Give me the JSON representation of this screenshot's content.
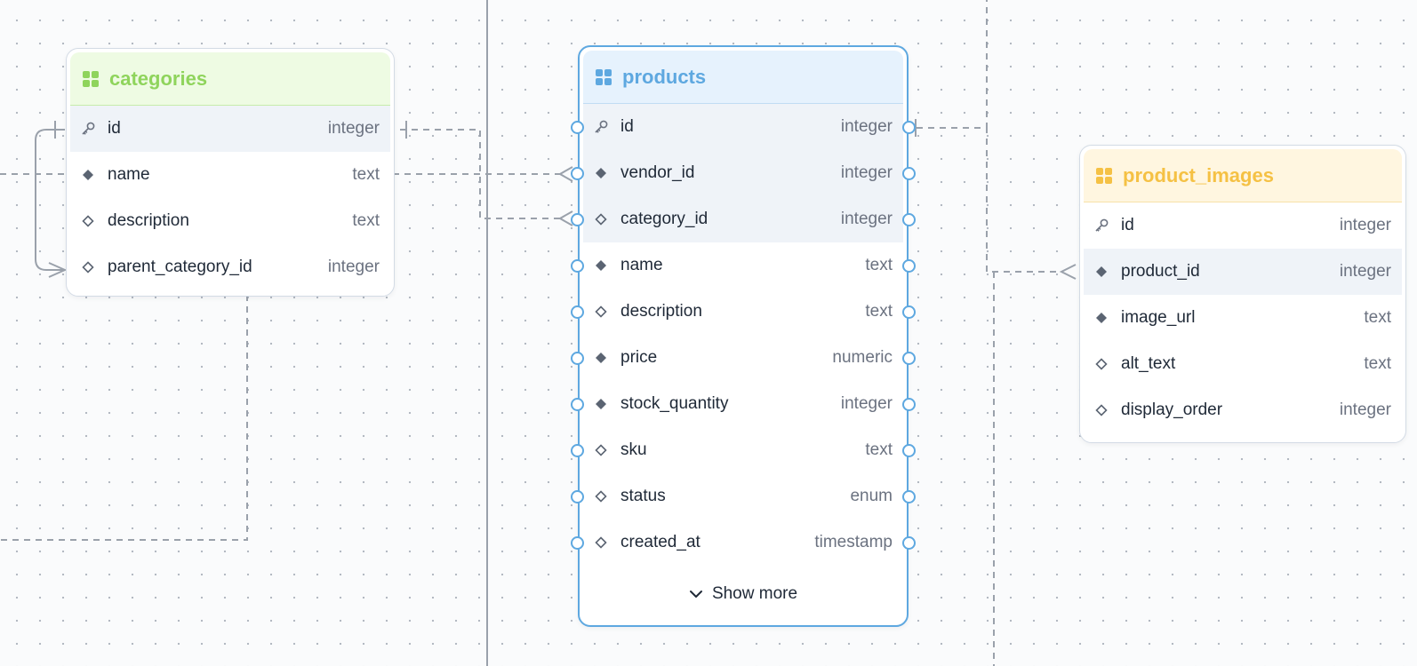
{
  "colors": {
    "accent": "#5ea8e0",
    "categories_header_bg": "#eefbe3",
    "categories_title": "#8fd45c",
    "products_header_bg": "#e6f2fd",
    "products_title": "#5ea8e0",
    "product_images_header_bg": "#fff6e0",
    "product_images_title": "#f5c144",
    "edge": "#9aa1ab"
  },
  "tables": {
    "categories": {
      "title": "categories",
      "icon": "table-grid-icon",
      "columns": [
        {
          "name": "id",
          "type": "integer",
          "icon": "key-icon"
        },
        {
          "name": "name",
          "type": "text",
          "icon": "filled-diamond-icon"
        },
        {
          "name": "description",
          "type": "text",
          "icon": "hollow-diamond-icon"
        },
        {
          "name": "parent_category_id",
          "type": "integer",
          "icon": "hollow-diamond-icon"
        }
      ]
    },
    "products": {
      "title": "products",
      "icon": "table-grid-icon",
      "columns": [
        {
          "name": "id",
          "type": "integer",
          "icon": "key-icon"
        },
        {
          "name": "vendor_id",
          "type": "integer",
          "icon": "filled-diamond-icon"
        },
        {
          "name": "category_id",
          "type": "integer",
          "icon": "hollow-diamond-icon"
        },
        {
          "name": "name",
          "type": "text",
          "icon": "filled-diamond-icon"
        },
        {
          "name": "description",
          "type": "text",
          "icon": "hollow-diamond-icon"
        },
        {
          "name": "price",
          "type": "numeric",
          "icon": "filled-diamond-icon"
        },
        {
          "name": "stock_quantity",
          "type": "integer",
          "icon": "filled-diamond-icon"
        },
        {
          "name": "sku",
          "type": "text",
          "icon": "hollow-diamond-icon"
        },
        {
          "name": "status",
          "type": "enum",
          "icon": "hollow-diamond-icon"
        },
        {
          "name": "created_at",
          "type": "timestamp",
          "icon": "hollow-diamond-icon"
        }
      ],
      "show_more_label": "Show more"
    },
    "product_images": {
      "title": "product_images",
      "icon": "table-grid-icon",
      "columns": [
        {
          "name": "id",
          "type": "integer",
          "icon": "key-icon"
        },
        {
          "name": "product_id",
          "type": "integer",
          "icon": "filled-diamond-icon"
        },
        {
          "name": "image_url",
          "type": "text",
          "icon": "filled-diamond-icon"
        },
        {
          "name": "alt_text",
          "type": "text",
          "icon": "hollow-diamond-icon"
        },
        {
          "name": "display_order",
          "type": "integer",
          "icon": "hollow-diamond-icon"
        }
      ]
    }
  }
}
